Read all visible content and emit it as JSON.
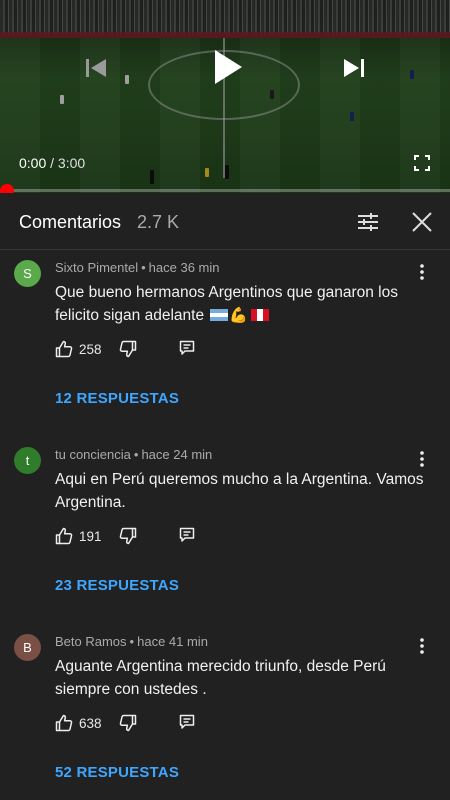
{
  "player": {
    "current_time": "0:00",
    "separator": " / ",
    "duration": "3:00",
    "progress_fraction": 0.0
  },
  "comments_header": {
    "title": "Comentarios",
    "count": "2.7 K"
  },
  "icons": {
    "play": "play-icon",
    "previous": "skip-previous-icon",
    "next": "skip-next-icon",
    "fullscreen": "fullscreen-icon",
    "filter": "sort-filter-icon",
    "close": "close-icon",
    "like": "thumbs-up-icon",
    "dislike": "thumbs-down-icon",
    "reply": "reply-comment-icon",
    "more": "more-vert-icon"
  },
  "comments": [
    {
      "avatar_letter": "S",
      "avatar_color": "#5aa94a",
      "author": "Sixto Pimentel",
      "time": "hace 36 min",
      "text": "Que bueno hermanos Argentinos que ganaron los felicito sigan adelante",
      "emoji_text": "💪",
      "likes": "258",
      "replies": "12 RESPUESTAS"
    },
    {
      "avatar_letter": "t",
      "avatar_color": "#2f7d2a",
      "author": "tu conciencia",
      "time": "hace 24 min",
      "text": "Aqui en Perú queremos mucho a la Argentina. Vamos Argentina.",
      "likes": "191",
      "replies": "23 RESPUESTAS"
    },
    {
      "avatar_letter": "B",
      "avatar_color": "#7a4f45",
      "author": "Beto Ramos",
      "time": "hace 41 min",
      "text": "Aguante Argentina merecido triunfo,  desde Perú siempre con ustedes .",
      "likes": "638",
      "replies": "52 RESPUESTAS"
    }
  ]
}
